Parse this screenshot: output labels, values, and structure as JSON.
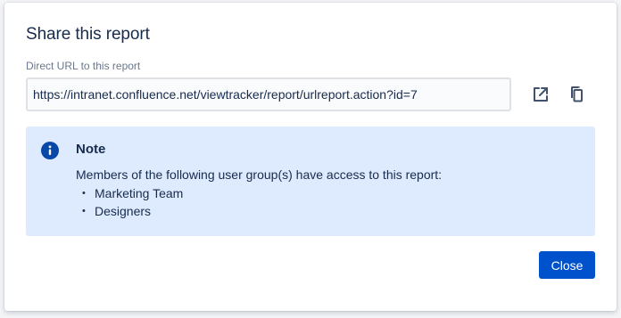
{
  "dialog": {
    "title": "Share this report",
    "url_label": "Direct URL to this report",
    "url_value": "https://intranet.confluence.net/viewtracker/report/urlreport.action?id=7",
    "actions": {
      "open_icon": "open-in-new-icon",
      "copy_icon": "copy-icon"
    },
    "note": {
      "icon": "info-icon",
      "heading": "Note",
      "text": "Members of the following user group(s) have access to this report:",
      "groups": [
        "Marketing Team",
        "Designers"
      ]
    },
    "close_label": "Close"
  },
  "colors": {
    "primary": "#0052cc",
    "note_bg": "#deebff",
    "text": "#172b4d",
    "muted": "#6b778c",
    "icon": "#42526e"
  }
}
